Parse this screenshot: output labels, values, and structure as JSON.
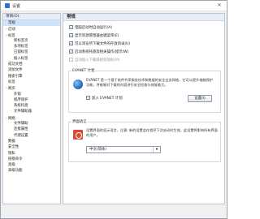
{
  "window": {
    "title": "设置",
    "close_icon": "close-icon"
  },
  "sidebar": {
    "header": "项目(O):",
    "items": [
      {
        "label": "常规",
        "level": 0,
        "expander": "",
        "selected": true
      },
      {
        "label": "启动",
        "level": 0,
        "expander": "−",
        "selected": false
      },
      {
        "label": "标签",
        "level": 0,
        "expander": "−",
        "selected": false
      },
      {
        "label": "新标签页",
        "level": 1,
        "expander": "",
        "selected": false
      },
      {
        "label": "多项标签",
        "level": 1,
        "expander": "",
        "selected": false
      },
      {
        "label": "已锁标签",
        "level": 1,
        "expander": "",
        "selected": false
      },
      {
        "label": "插入标签",
        "level": 1,
        "expander": "",
        "selected": false
      },
      {
        "label": "成功文档",
        "level": 0,
        "expander": "",
        "selected": false
      },
      {
        "label": "添加文件",
        "level": 0,
        "expander": "",
        "selected": false
      },
      {
        "label": "搜索引擎",
        "level": 0,
        "expander": "",
        "selected": false
      },
      {
        "label": "标签",
        "level": 0,
        "expander": "",
        "selected": false
      },
      {
        "label": "网页",
        "level": 0,
        "expander": "−",
        "selected": false
      },
      {
        "label": "外观",
        "level": 1,
        "expander": "",
        "selected": false
      },
      {
        "label": "程序保护",
        "level": 1,
        "expander": "",
        "selected": false
      },
      {
        "label": "系统托盘",
        "level": 1,
        "expander": "",
        "selected": false
      },
      {
        "label": "文件辅助器",
        "level": 1,
        "expander": "",
        "selected": false
      },
      {
        "label": "网络",
        "level": 0,
        "expander": "−",
        "selected": false
      },
      {
        "label": "文件辅助",
        "level": 1,
        "expander": "",
        "selected": false
      },
      {
        "label": "连接属性",
        "level": 1,
        "expander": "",
        "selected": false
      },
      {
        "label": "代理设置",
        "level": 1,
        "expander": "",
        "selected": false
      },
      {
        "label": "数据",
        "level": 0,
        "expander": "",
        "selected": false
      },
      {
        "label": "安全性",
        "level": 0,
        "expander": "",
        "selected": false
      },
      {
        "label": "隐私",
        "level": 0,
        "expander": "",
        "selected": false
      },
      {
        "label": "链接命令",
        "level": 0,
        "expander": "",
        "selected": false
      },
      {
        "label": "高级",
        "level": 0,
        "expander": "",
        "selected": false
      },
      {
        "label": "高级功能",
        "level": 0,
        "expander": "",
        "selected": false
      }
    ]
  },
  "content": {
    "title": "常规",
    "checkboxes": [
      {
        "label": "电脑启动时自动运行(A)",
        "checked": true,
        "disabled": false
      },
      {
        "label": "显示资源管理器右键菜单(E)",
        "checked": true,
        "disabled": false
      },
      {
        "label": "可以浏览所下载文件的存放目录(U)",
        "checked": true,
        "disabled": false
      },
      {
        "label": "启动系统托盘及相关操作(提示/W)",
        "checked": true,
        "disabled": false
      },
      {
        "label": "自动插入下载链接剪贴板(M)",
        "checked": false,
        "disabled": true
      }
    ],
    "evanet": {
      "title": "EVANET 计划",
      "icon": "globe-icon",
      "description": "EVANET 是一个基于软件共享服务技术和数据的安全业务网络，它可以提升电脑保护功能，并能够对下载的内容进行安全检查与修复能力。",
      "join_label": "加入 EVANET 计划",
      "join_checked": true,
      "settings_button": "设置(I)"
    },
    "language": {
      "title": "界面语言",
      "icon": "language-icon",
      "description": "设置界面的显示语言，注意: 新的设置会在程序下次启动时生效，此设置将影响所有界面的用户。",
      "selected": "中文(简体)",
      "arrow_icon": "chevron-down-icon"
    }
  }
}
